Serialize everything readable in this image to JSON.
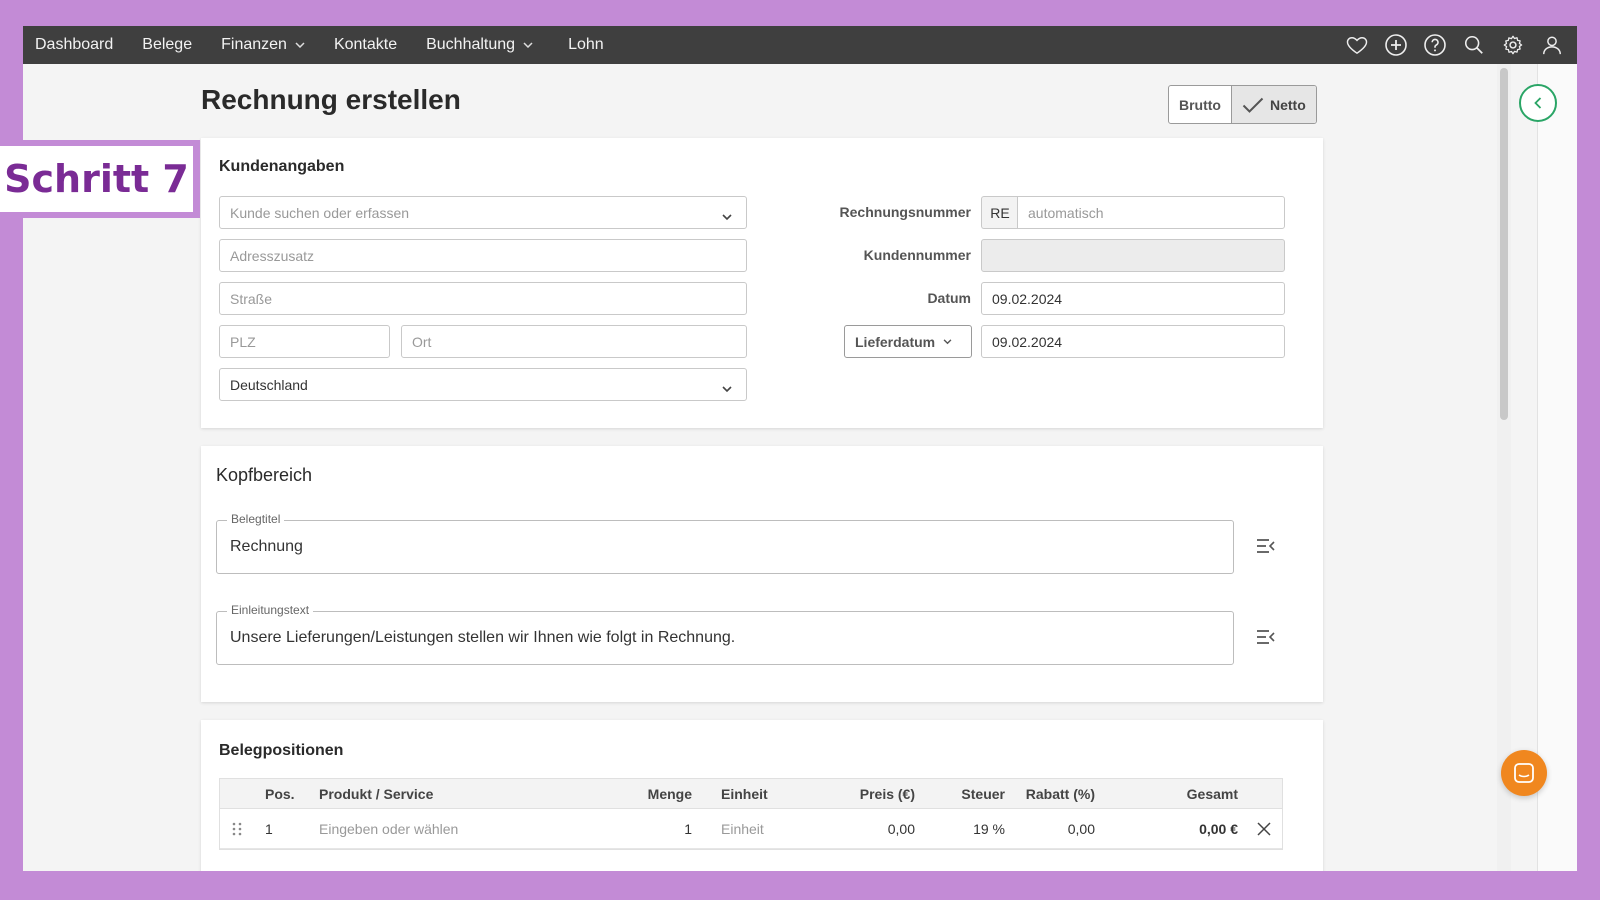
{
  "nav": {
    "items": [
      {
        "label": "Dashboard",
        "has_dropdown": false
      },
      {
        "label": "Belege",
        "has_dropdown": false
      },
      {
        "label": "Finanzen",
        "has_dropdown": true
      },
      {
        "label": "Kontakte",
        "has_dropdown": false
      },
      {
        "label": "Buchhaltung",
        "has_dropdown": true
      },
      {
        "label": "Lohn",
        "has_dropdown": false
      }
    ],
    "icons": [
      "heart-icon",
      "plus-circle-icon",
      "help-icon",
      "search-icon",
      "gear-icon",
      "user-icon"
    ]
  },
  "page": {
    "title": "Rechnung erstellen",
    "toggle": {
      "brutto": "Brutto",
      "netto": "Netto",
      "selected": "Netto"
    }
  },
  "customer": {
    "heading": "Kundenangaben",
    "search_placeholder": "Kunde suchen oder erfassen",
    "address_extra_placeholder": "Adresszusatz",
    "street_placeholder": "Straße",
    "zip_placeholder": "PLZ",
    "city_placeholder": "Ort",
    "country": "Deutschland"
  },
  "invoice_meta": {
    "number_label": "Rechnungsnummer",
    "number_prefix": "RE",
    "number_placeholder": "automatisch",
    "customer_number_label": "Kundennummer",
    "customer_number_value": "",
    "date_label": "Datum",
    "date_value": "09.02.2024",
    "delivery_label": "Lieferdatum",
    "delivery_value": "09.02.2024"
  },
  "header_section": {
    "heading": "Kopfbereich",
    "title_legend": "Belegtitel",
    "title_value": "Rechnung",
    "intro_legend": "Einleitungstext",
    "intro_value": "Unsere Lieferungen/Leistungen stellen wir Ihnen wie folgt in Rechnung."
  },
  "positions": {
    "heading": "Belegpositionen",
    "columns": {
      "pos": "Pos.",
      "product": "Produkt / Service",
      "qty": "Menge",
      "unit": "Einheit",
      "price": "Preis (€)",
      "tax": "Steuer",
      "discount": "Rabatt (%)",
      "total": "Gesamt"
    },
    "rows": [
      {
        "pos": "1",
        "product": "Eingeben oder wählen",
        "qty": "1",
        "unit": "Einheit",
        "price": "0,00",
        "tax": "19 %",
        "discount": "0,00",
        "total": "0,00 €"
      }
    ]
  },
  "overlay": {
    "step": "Schritt 7"
  }
}
